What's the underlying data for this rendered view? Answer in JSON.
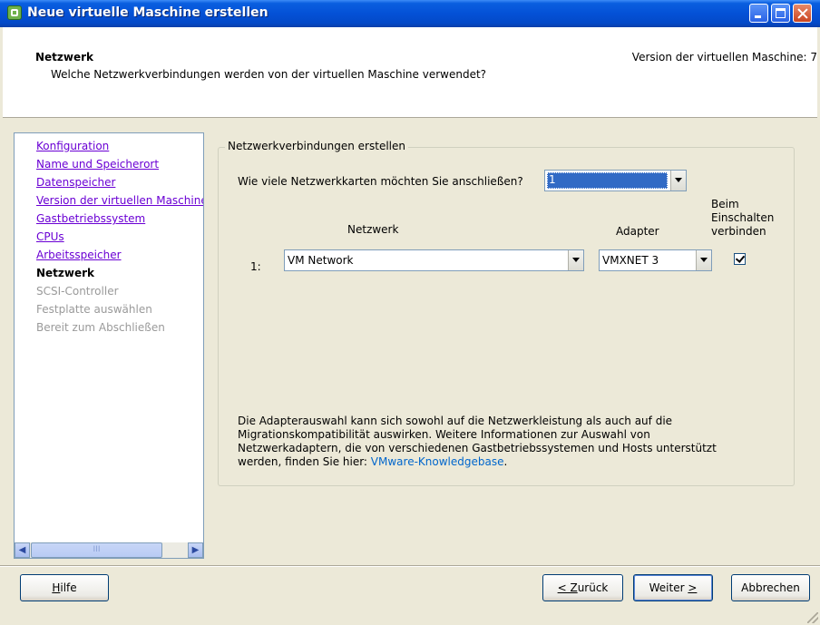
{
  "window": {
    "title": "Neue virtuelle Maschine erstellen",
    "icon": "vm-wizard-icon"
  },
  "header": {
    "title": "Netzwerk",
    "subtitle": "Welche Netzwerkverbindungen werden von der virtuellen Maschine verwendet?",
    "version": "Version der virtuellen Maschine: 7"
  },
  "nav": {
    "items": [
      {
        "label": "Konfiguration",
        "state": "link"
      },
      {
        "label": "Name und Speicherort",
        "state": "link"
      },
      {
        "label": "Datenspeicher",
        "state": "link"
      },
      {
        "label": "Version der virtuellen Maschine",
        "state": "link"
      },
      {
        "label": "Gastbetriebssystem",
        "state": "link"
      },
      {
        "label": "CPUs",
        "state": "link"
      },
      {
        "label": "Arbeitsspeicher",
        "state": "link"
      },
      {
        "label": "Netzwerk",
        "state": "current"
      },
      {
        "label": "SCSI-Controller",
        "state": "disabled"
      },
      {
        "label": "Festplatte auswählen",
        "state": "disabled"
      },
      {
        "label": "Bereit zum Abschließen",
        "state": "disabled"
      }
    ],
    "scroll_thumb": "III"
  },
  "main": {
    "group_title": "Netzwerkverbindungen erstellen",
    "nic_question": "Wie viele Netzwerkkarten möchten Sie anschließen?",
    "nic_count": "1",
    "col_network": "Netzwerk",
    "col_adapter": "Adapter",
    "col_connect": "Beim Einschalten verbinden",
    "row": {
      "index": "1:",
      "network": "VM Network",
      "adapter": "VMXNET 3",
      "connect_checked": true
    },
    "info_text": "Die Adapterauswahl kann sich sowohl auf die Netzwerkleistung als auch auf die Migrationskompatibilität auswirken. Weitere Informationen zur Auswahl von Netzwerkadaptern, die von verschiedenen Gastbetriebssystemen und Hosts unterstützt werden, finden Sie hier: ",
    "info_link": "VMware-Knowledgebase",
    "info_end": "."
  },
  "footer": {
    "help": {
      "u": "H",
      "rest": "ilfe"
    },
    "back": {
      "u": "< Z",
      "rest": "urück"
    },
    "next": {
      "pre": "Weiter ",
      "u": ">"
    },
    "cancel": "Abbrechen"
  },
  "colors": {
    "title_bar": "#0451d6",
    "link": "#6a00d4",
    "kb_link": "#0066cc",
    "selection": "#316ac5"
  }
}
